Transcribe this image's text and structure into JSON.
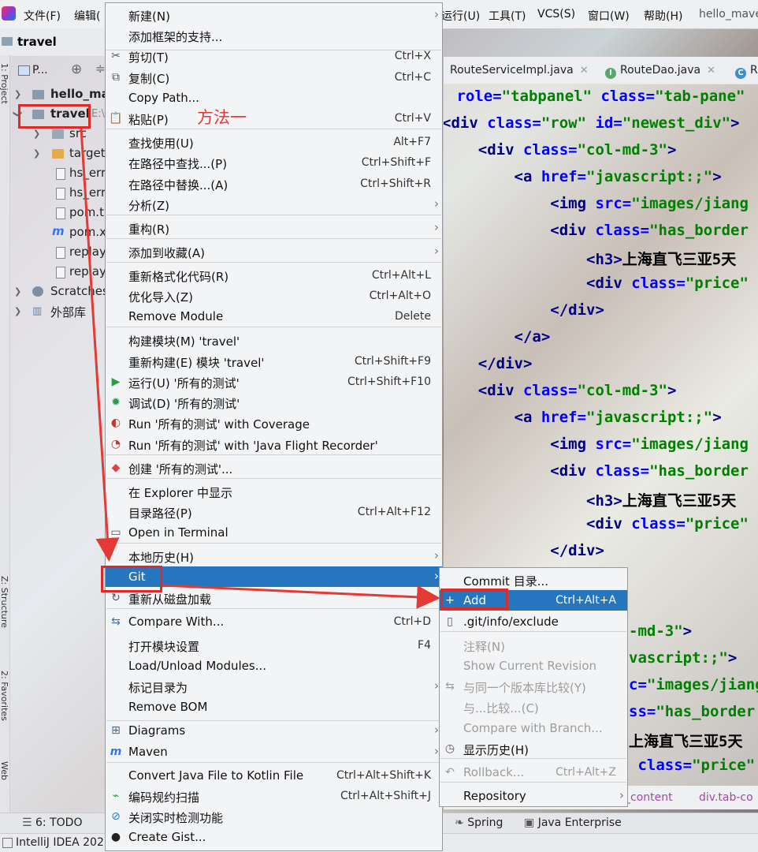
{
  "menubar": {
    "items": [
      "文件(F)",
      "编辑(",
      "运行(U)",
      "工具(T)",
      "VCS(S)",
      "窗口(W)",
      "帮助(H)",
      "hello_mave"
    ]
  },
  "navbar": {
    "project": "travel"
  },
  "sidebar": {
    "project_tab": "1: Project",
    "structure_tab": "Z: Structure",
    "favorites_tab": "2: Favorites",
    "web_tab": "Web"
  },
  "project": {
    "header": "P...",
    "tree": [
      {
        "label": "hello_ma",
        "bold": true
      },
      {
        "label": "travel",
        "bold": true,
        "suffix": "E:\\"
      },
      {
        "label": "src"
      },
      {
        "label": "target"
      },
      {
        "label": "hs_err"
      },
      {
        "label": "hs_err"
      },
      {
        "label": "pom.t"
      },
      {
        "label": "pom.x"
      },
      {
        "label": "replay"
      },
      {
        "label": "replay"
      },
      {
        "label": "Scratches"
      },
      {
        "label": "外部库"
      }
    ]
  },
  "editor": {
    "tabs": [
      {
        "label": "RouteServiceImpl.java",
        "icon": "c-icon"
      },
      {
        "label": "RouteDao.java",
        "icon": "i-icon"
      },
      {
        "label": "R",
        "icon": "c-icon"
      }
    ],
    "breadcrumb": [
      "_content",
      "div.tab-co"
    ]
  },
  "bottombar": {
    "todo": "6: TODO",
    "spring": "Spring",
    "java_ee": "Java Enterprise"
  },
  "statusbar": {
    "title": "IntelliJ IDEA 202"
  },
  "annotation": {
    "text": "方法一",
    "color": "#e53935"
  },
  "context_menu": {
    "items": [
      {
        "label": "新建(N)",
        "shortcut": "",
        "submenu": true
      },
      {
        "label": "添加框架的支持...",
        "shortcut": ""
      },
      {
        "label": "剪切(T)",
        "shortcut": "Ctrl+X",
        "icon": "scissors-icon"
      },
      {
        "label": "复制(C)",
        "shortcut": "Ctrl+C",
        "icon": "copy-icon"
      },
      {
        "label": "Copy Path...",
        "shortcut": ""
      },
      {
        "label": "粘贴(P)",
        "shortcut": "Ctrl+V",
        "icon": "paste-icon"
      },
      {
        "label": "查找使用(U)",
        "shortcut": "Alt+F7"
      },
      {
        "label": "在路径中查找...(P)",
        "shortcut": "Ctrl+Shift+F"
      },
      {
        "label": "在路径中替换...(A)",
        "shortcut": "Ctrl+Shift+R"
      },
      {
        "label": "分析(Z)",
        "shortcut": "",
        "submenu": true
      },
      {
        "label": "重构(R)",
        "shortcut": "",
        "submenu": true
      },
      {
        "label": "添加到收藏(A)",
        "shortcut": "",
        "submenu": true
      },
      {
        "label": "重新格式化代码(R)",
        "shortcut": "Ctrl+Alt+L"
      },
      {
        "label": "优化导入(Z)",
        "shortcut": "Ctrl+Alt+O"
      },
      {
        "label": "Remove Module",
        "shortcut": "Delete"
      },
      {
        "label": "构建模块(M) 'travel'",
        "shortcut": ""
      },
      {
        "label": "重新构建(E) 模块 'travel'",
        "shortcut": "Ctrl+Shift+F9"
      },
      {
        "label": "运行(U) '所有的测试'",
        "shortcut": "Ctrl+Shift+F10",
        "icon": "run-icon"
      },
      {
        "label": "调试(D) '所有的测试'",
        "shortcut": "",
        "icon": "debug-icon"
      },
      {
        "label": "Run '所有的测试' with Coverage",
        "shortcut": "",
        "icon": "coverage-icon"
      },
      {
        "label": "Run '所有的测试' with 'Java Flight Recorder'",
        "shortcut": "",
        "icon": "profiler-icon"
      },
      {
        "label": "创建 '所有的测试'...",
        "shortcut": "",
        "icon": "create-test-icon"
      },
      {
        "label": "在 Explorer 中显示",
        "shortcut": ""
      },
      {
        "label": "目录路径(P)",
        "shortcut": "Ctrl+Alt+F12"
      },
      {
        "label": "Open in Terminal",
        "shortcut": "",
        "icon": "terminal-icon"
      },
      {
        "label": "本地历史(H)",
        "shortcut": "",
        "submenu": true
      },
      {
        "label": "Git",
        "shortcut": "",
        "submenu": true,
        "highlighted": true
      },
      {
        "label": "重新从磁盘加载",
        "shortcut": "",
        "icon": "reload-icon"
      },
      {
        "label": "Compare With...",
        "shortcut": "Ctrl+D",
        "icon": "compare-icon"
      },
      {
        "label": "打开模块设置",
        "shortcut": "F4"
      },
      {
        "label": "Load/Unload Modules...",
        "shortcut": ""
      },
      {
        "label": "标记目录为",
        "shortcut": "",
        "submenu": true
      },
      {
        "label": "Remove BOM",
        "shortcut": ""
      },
      {
        "label": "Diagrams",
        "shortcut": "",
        "submenu": true,
        "icon": "diagrams-icon"
      },
      {
        "label": "Maven",
        "shortcut": "",
        "submenu": true,
        "icon": "maven-icon"
      },
      {
        "label": "Convert Java File to Kotlin File",
        "shortcut": "Ctrl+Alt+Shift+K"
      },
      {
        "label": "编码规约扫描",
        "shortcut": "Ctrl+Alt+Shift+J",
        "icon": "scan-icon"
      },
      {
        "label": "关闭实时检测功能",
        "shortcut": "",
        "icon": "disable-icon"
      },
      {
        "label": "Create Gist...",
        "shortcut": "",
        "icon": "github-icon"
      }
    ]
  },
  "git_submenu": {
    "items": [
      {
        "label": "Commit 目录...",
        "shortcut": ""
      },
      {
        "label": "Add",
        "shortcut": "Ctrl+Alt+A",
        "highlighted": true,
        "icon": "plus-icon"
      },
      {
        "label": ".git/info/exclude",
        "shortcut": "",
        "icon": "file-icon"
      },
      {
        "label": "注释(N)",
        "shortcut": "",
        "disabled": true
      },
      {
        "label": "Show Current Revision",
        "shortcut": "",
        "disabled": true
      },
      {
        "label": "与同一个版本库比较(Y)",
        "shortcut": "",
        "disabled": true,
        "icon": "compare-icon"
      },
      {
        "label": "与...比较...(C)",
        "shortcut": "",
        "disabled": true
      },
      {
        "label": "Compare with Branch...",
        "shortcut": "",
        "disabled": true
      },
      {
        "label": "显示历史(H)",
        "shortcut": "",
        "icon": "history-icon"
      },
      {
        "label": "Rollback...",
        "shortcut": "Ctrl+Alt+Z",
        "disabled": true,
        "icon": "rollback-icon"
      },
      {
        "label": "Repository",
        "shortcut": "",
        "submenu": true
      }
    ]
  },
  "code": {
    "lines": [
      {
        "segments": [
          [
            "att",
            " role="
          ],
          [
            "str",
            "\"tabpanel\""
          ],
          [
            "att",
            " class="
          ],
          [
            "str",
            "\"tab-pane\""
          ]
        ]
      },
      {
        "segments": [
          [
            "tag",
            "<div"
          ],
          [
            "att",
            " class="
          ],
          [
            "str",
            "\"row\""
          ],
          [
            "att",
            " id="
          ],
          [
            "str",
            "\"newest_div\""
          ],
          [
            "tag",
            ">"
          ]
        ]
      },
      {
        "segments": [
          [
            "tag",
            "    <div"
          ],
          [
            "att",
            " class="
          ],
          [
            "str",
            "\"col-md-3\""
          ],
          [
            "tag",
            ">"
          ]
        ]
      },
      {
        "segments": [
          [
            "tag",
            "        <a"
          ],
          [
            "att",
            " href="
          ],
          [
            "str",
            "\"javascript:;\""
          ],
          [
            "tag",
            ">"
          ]
        ]
      },
      {
        "segments": [
          [
            "tag",
            "            <img"
          ],
          [
            "att",
            " src="
          ],
          [
            "str",
            "\"images/jiang"
          ]
        ]
      },
      {
        "segments": [
          [
            "tag",
            "            <div"
          ],
          [
            "att",
            " class="
          ],
          [
            "str",
            "\"has_border"
          ]
        ]
      },
      {
        "segments": [
          [
            "tag",
            "                <h3>"
          ],
          [
            "txt",
            "上海直飞三亚5天"
          ]
        ]
      },
      {
        "segments": [
          [
            "tag",
            "                <div"
          ],
          [
            "att",
            " class="
          ],
          [
            "str",
            "\"price\""
          ]
        ]
      },
      {
        "segments": [
          [
            "tag",
            "            </div>"
          ]
        ]
      },
      {
        "segments": [
          [
            "tag",
            "        </a>"
          ]
        ]
      },
      {
        "segments": [
          [
            "tag",
            "    </div>"
          ]
        ]
      },
      {
        "segments": [
          [
            "tag",
            "    <div"
          ],
          [
            "att",
            " class="
          ],
          [
            "str",
            "\"col-md-3\""
          ],
          [
            "tag",
            ">"
          ]
        ]
      },
      {
        "segments": [
          [
            "tag",
            "        <a"
          ],
          [
            "att",
            " href="
          ],
          [
            "str",
            "\"javascript:;\""
          ],
          [
            "tag",
            ">"
          ]
        ]
      },
      {
        "segments": [
          [
            "tag",
            "            <img"
          ],
          [
            "att",
            " src="
          ],
          [
            "str",
            "\"images/jiang"
          ]
        ]
      },
      {
        "segments": [
          [
            "tag",
            "            <div"
          ],
          [
            "att",
            " class="
          ],
          [
            "str",
            "\"has_border"
          ]
        ]
      },
      {
        "segments": [
          [
            "tag",
            "                <h3>"
          ],
          [
            "txt",
            "上海直飞三亚5天"
          ]
        ]
      },
      {
        "segments": [
          [
            "tag",
            "                <div"
          ],
          [
            "att",
            " class="
          ],
          [
            "str",
            "\"price\""
          ]
        ]
      },
      {
        "segments": [
          [
            "tag",
            "            </div>"
          ]
        ]
      },
      {
        "segments": [
          [
            "txt",
            ""
          ]
        ]
      },
      {
        "segments": [
          [
            "txt",
            ""
          ]
        ]
      },
      {
        "segments": [
          [
            "txt",
            ""
          ],
          [
            "str",
            "-md-3\""
          ],
          [
            "tag",
            ">"
          ]
        ]
      },
      {
        "segments": [
          [
            "txt",
            ""
          ],
          [
            "str",
            "vascript:;\""
          ],
          [
            "tag",
            ">"
          ]
        ]
      },
      {
        "segments": [
          [
            "txt",
            ""
          ],
          [
            "att",
            "c="
          ],
          [
            "str",
            "\"images/jiang"
          ]
        ]
      },
      {
        "segments": [
          [
            "txt",
            ""
          ],
          [
            "att",
            "ss="
          ],
          [
            "str",
            "\"has_border"
          ]
        ]
      },
      {
        "segments": [
          [
            "txt",
            ""
          ],
          [
            "txt",
            "上海直飞三亚5天"
          ]
        ]
      },
      {
        "segments": [
          [
            "txt",
            ""
          ],
          [
            "att",
            " class="
          ],
          [
            "str",
            "\"price\""
          ]
        ]
      }
    ]
  }
}
